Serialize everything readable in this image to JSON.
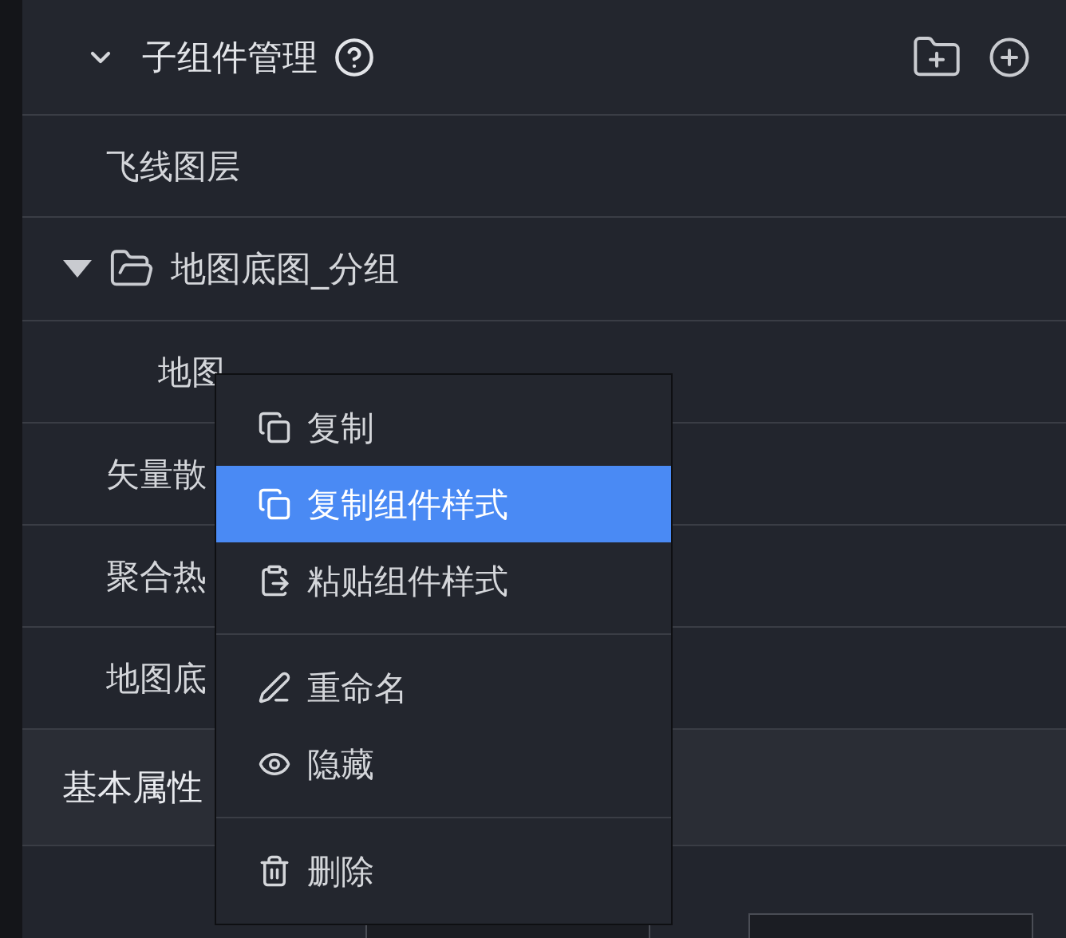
{
  "panel": {
    "title": "子组件管理",
    "expanded": true
  },
  "layers": [
    {
      "kind": "item",
      "label": "飞线图层"
    },
    {
      "kind": "group",
      "label": "地图底图_分组",
      "expanded": true,
      "children": [
        {
          "kind": "item",
          "label": "地图"
        }
      ]
    },
    {
      "kind": "item",
      "label": "矢量散"
    },
    {
      "kind": "item",
      "label": "聚合热"
    },
    {
      "kind": "item",
      "label": "地图底"
    }
  ],
  "section": {
    "title": "基本属性"
  },
  "context_menu": [
    {
      "kind": "item",
      "label": "复制",
      "selected": false
    },
    {
      "kind": "item",
      "label": "复制组件样式",
      "selected": true
    },
    {
      "kind": "item",
      "label": "粘贴组件样式",
      "selected": false
    },
    {
      "kind": "divider"
    },
    {
      "kind": "item",
      "label": "重命名",
      "selected": false
    },
    {
      "kind": "item",
      "label": "隐藏",
      "selected": false
    },
    {
      "kind": "divider"
    },
    {
      "kind": "item",
      "label": "删除",
      "selected": false
    }
  ]
}
